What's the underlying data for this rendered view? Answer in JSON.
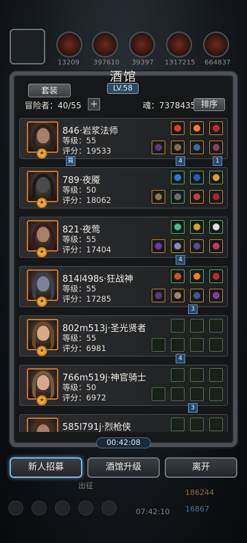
{
  "top_bar": {
    "values": [
      "13209",
      "397610",
      "39397",
      "1317215",
      "664837"
    ]
  },
  "panel": {
    "title": "酒馆",
    "level": "LV.58",
    "set_button": "套装",
    "adventurers_label": "冒险者：40/55",
    "add_symbol": "+",
    "soul_label": "魂：7378435",
    "sort_button": "排序"
  },
  "heroes": [
    {
      "name": "846·岩浆法师",
      "level": "等级：55",
      "score": "评分：19533"
    },
    {
      "name": "789·夜魇",
      "level": "等级：50",
      "score": "评分：18062"
    },
    {
      "name": "821·夜莺",
      "level": "等级：55",
      "score": "评分：17404"
    },
    {
      "name": "814l498s·狂战神",
      "level": "等级：55",
      "score": "评分：17285"
    },
    {
      "name": "802m513j·圣光贤者",
      "level": "等级：55",
      "score": "评分：6981"
    },
    {
      "name": "766m519j·神官骑士",
      "level": "等级：50",
      "score": "评分：6972"
    },
    {
      "name": "585l791j·烈枪侠",
      "level": "",
      "score": ""
    }
  ],
  "link_tags": [
    "竟",
    "4",
    "1",
    "4",
    "3",
    "4",
    "3"
  ],
  "timer": "00:42:08",
  "buttons": {
    "recruit": "新人招募",
    "upgrade": "酒馆升级",
    "leave": "离开"
  },
  "footer": {
    "label": "出征",
    "time": "07:42:10",
    "gold": "186244",
    "gems": "16867"
  },
  "colors": {
    "frame": "#4c5157",
    "accent_blue": "#7fb4d8",
    "portrait_border": "#c8742d"
  }
}
